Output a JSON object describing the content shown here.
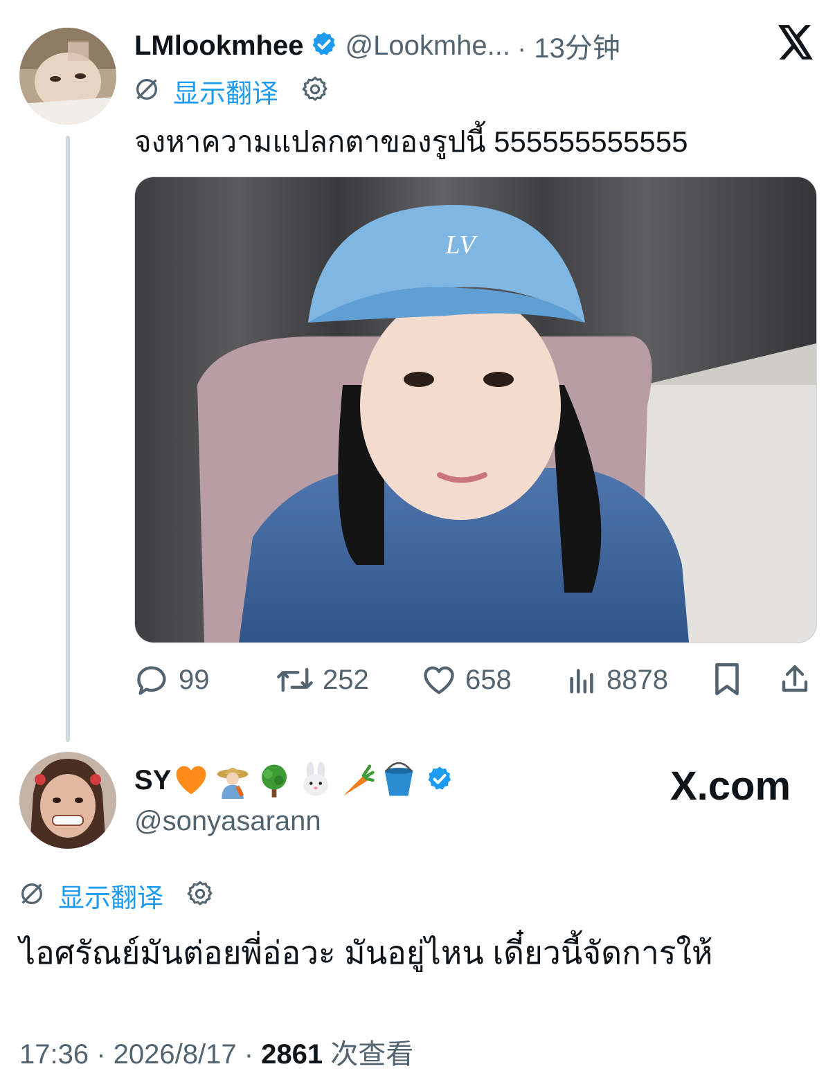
{
  "icons": {
    "x_logo": "x-logo-icon",
    "verified": "verified-badge-icon",
    "translate": "translate-globe-icon",
    "settings": "gear-icon",
    "reply": "reply-bubble-icon",
    "retweet": "retweet-icon",
    "like": "heart-icon",
    "views": "bar-chart-icon",
    "bookmark": "bookmark-icon",
    "share": "share-upload-icon"
  },
  "colors": {
    "accent": "#1d9bf0",
    "secondary_text": "#536471",
    "thread_line": "#cfd9de"
  },
  "tweet": {
    "author_name": "LMlookmhee",
    "author_handle": "@Lookmhe...",
    "time": "· 13分钟",
    "translate_label": "显示翻译",
    "text": "จงหาความแปลกตาของรูปนี้ 555555555555",
    "stats": {
      "replies": "99",
      "retweets": "252",
      "likes": "658",
      "views": "8878"
    }
  },
  "reply": {
    "author_name": "SY",
    "author_emojis": [
      "orange-heart",
      "farmer",
      "tree",
      "rabbit-face",
      "carrot",
      "bucket"
    ],
    "author_handle": "@sonyasarann",
    "translate_label": "显示翻译",
    "text": "ไอศรัณย์มันต่อยพี่อ่อวะ มันอยู่ไหน เดี๋ยวนี้จัดการให้",
    "timestamp": "17:36 · 2026/8/17 ·",
    "view_count": "2861",
    "view_label": "次查看"
  },
  "watermark": "X.com"
}
